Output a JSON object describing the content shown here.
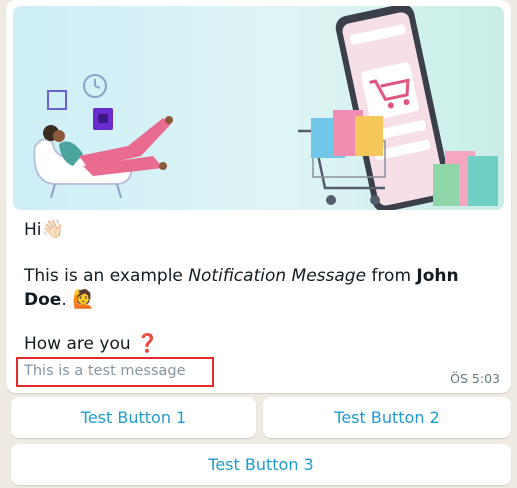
{
  "message": {
    "greeting": "Hi",
    "greeting_emoji": "👋🏻",
    "line2_pre": "This is an example ",
    "line2_italic": "Notification Message",
    "line2_mid": " from ",
    "line2_bold": "John Doe",
    "line2_end": ".",
    "line2_emoji": "🙋",
    "question": "How are you",
    "question_emoji": "❓",
    "footer": "This is a test message",
    "timestamp": "ÖS 5:03"
  },
  "buttons": [
    {
      "label": "Test Button 1"
    },
    {
      "label": "Test Button 2"
    },
    {
      "label": "Test Button 3"
    }
  ],
  "icons": {
    "banner": "online-shopping-illustration",
    "greeting": "waving-hand-icon",
    "person": "person-raising-hand-icon",
    "question": "question-mark-icon"
  },
  "colors": {
    "button_text": "#1f9bd0",
    "highlight_border": "#e32b2b",
    "footer_text": "#8696a0"
  }
}
